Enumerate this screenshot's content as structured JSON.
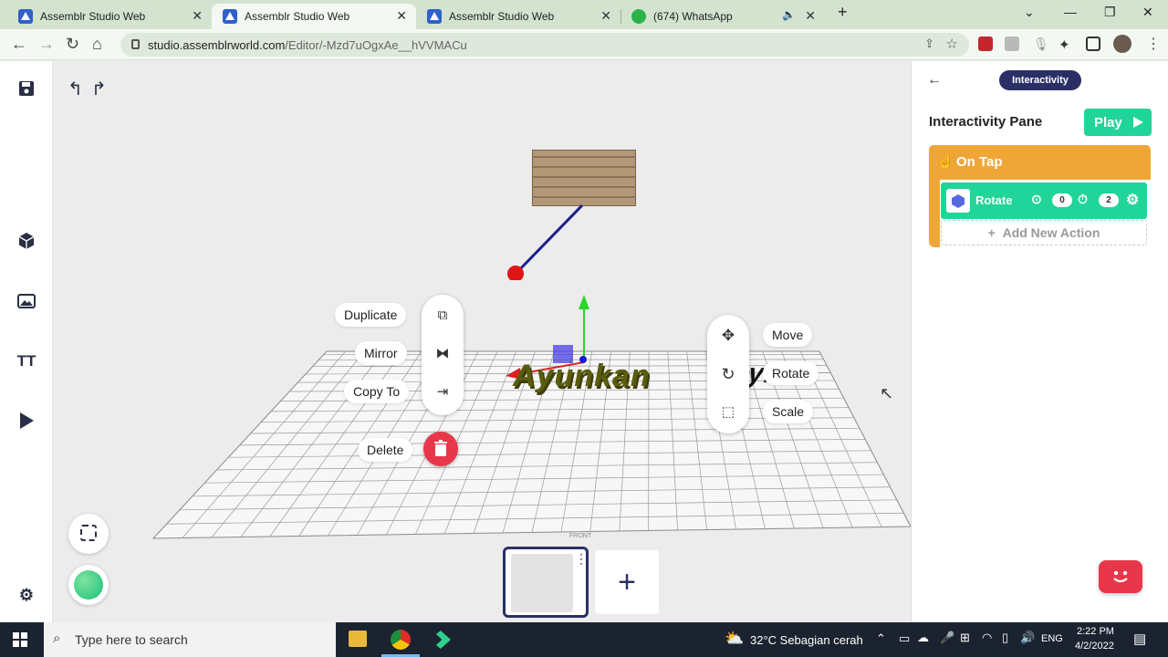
{
  "browser": {
    "tabs": [
      {
        "title": "Assemblr Studio Web",
        "active": false
      },
      {
        "title": "Assemblr Studio Web",
        "active": true
      },
      {
        "title": "Assemblr Studio Web",
        "active": false
      },
      {
        "title": "(674) WhatsApp",
        "active": false
      }
    ],
    "url_host": "studio.assemblrworld.com",
    "url_path": "/Editor/-Mzd7uOgxAe__hVVMACu"
  },
  "canvas": {
    "object_text": "Ayunkan",
    "left_menu": {
      "duplicate_label": "Duplicate",
      "mirror_label": "Mirror",
      "copy_to_label": "Copy To",
      "delete_label": "Delete"
    },
    "right_menu": {
      "move_label": "Move",
      "rotate_label": "Rotate",
      "scale_label": "Scale"
    },
    "scene_label": "FRONT",
    "add_scene_label": "+"
  },
  "pane": {
    "badge": "Interactivity",
    "title": "Interactivity Pane",
    "play_label": "Play",
    "trigger_label": "On Tap",
    "action": {
      "label": "Rotate",
      "value_1": "0",
      "value_2": "2"
    },
    "add_action_label": "Add New Action"
  },
  "taskbar": {
    "search_placeholder": "Type here to search",
    "weather": "32°C  Sebagian cerah",
    "lang": "ENG",
    "time": "2:22 PM",
    "date": "4/2/2022"
  },
  "colors": {
    "accent_green": "#21d49a",
    "trigger_orange": "#f0a637",
    "badge_navy": "#2a3066",
    "delete_red": "#e8374a"
  }
}
